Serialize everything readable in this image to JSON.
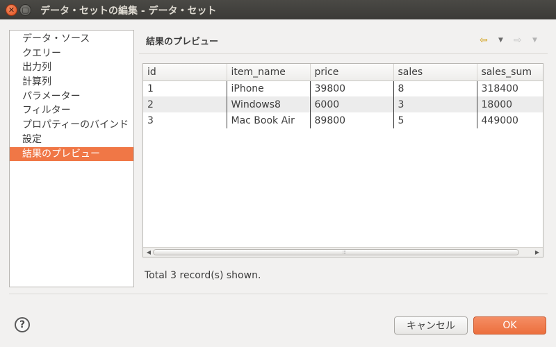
{
  "window": {
    "title": "データ・セットの編集 - データ・セット",
    "close_glyph": "✕",
    "max_glyph": "▢"
  },
  "nav": {
    "items": [
      {
        "label": "データ・ソース"
      },
      {
        "label": "クエリー"
      },
      {
        "label": "出力列"
      },
      {
        "label": "計算列"
      },
      {
        "label": "パラメーター"
      },
      {
        "label": "フィルター"
      },
      {
        "label": "プロパティーのバインド"
      },
      {
        "label": "設定"
      },
      {
        "label": "結果のプレビュー",
        "selected": true
      }
    ]
  },
  "panel": {
    "title": "結果のプレビュー",
    "back_icon": "⇦",
    "forward_icon": "⇨",
    "dropdown_icon": "▼"
  },
  "table": {
    "columns": [
      "id",
      "item_name",
      "price",
      "sales",
      "sales_sum"
    ],
    "rows": [
      [
        "1",
        "iPhone",
        "39800",
        "8",
        "318400"
      ],
      [
        "2",
        "Windows8",
        "6000",
        "3",
        "18000"
      ],
      [
        "3",
        "Mac Book Air",
        "89800",
        "5",
        "449000"
      ]
    ]
  },
  "status": "Total 3 record(s) shown.",
  "buttons": {
    "help": "?",
    "cancel": "キャンセル",
    "ok": "OK"
  },
  "colors": {
    "accent": "#f07746",
    "titlebar": "#3b3a37"
  }
}
